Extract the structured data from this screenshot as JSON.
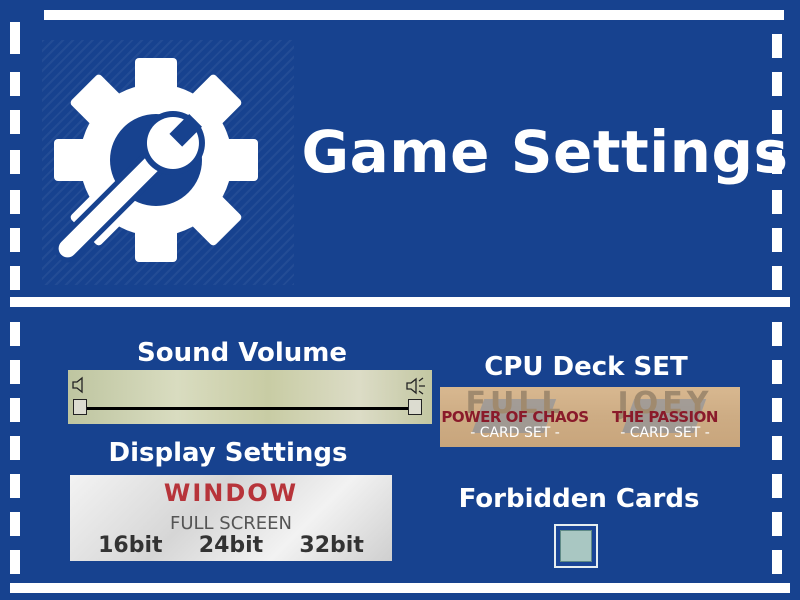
{
  "screen": {
    "title": "Game Settings"
  },
  "sound": {
    "label": "Sound Volume",
    "volume": 1.0
  },
  "display": {
    "label": "Display Settings",
    "window": "WINDOW",
    "fullscreen": "FULL SCREEN",
    "bits": [
      "16bit",
      "24bit",
      "32bit"
    ]
  },
  "cpu_deck": {
    "label": "CPU Deck SET",
    "options": [
      {
        "title": "FULL",
        "subtitle": "POWER OF CHAOS",
        "caption": "- CARD SET -"
      },
      {
        "title": "JOEY",
        "subtitle": "THE PASSION",
        "caption": "- CARD SET -"
      }
    ]
  },
  "forbidden": {
    "label": "Forbidden Cards",
    "checked": false
  },
  "colors": {
    "background": "#1a4596",
    "border": "#ffffff",
    "window_text": "#b7343a"
  },
  "icons": {
    "settings": "gear-wrench-icon",
    "speaker_low": "speaker-mute-icon",
    "speaker_high": "speaker-loud-icon"
  }
}
